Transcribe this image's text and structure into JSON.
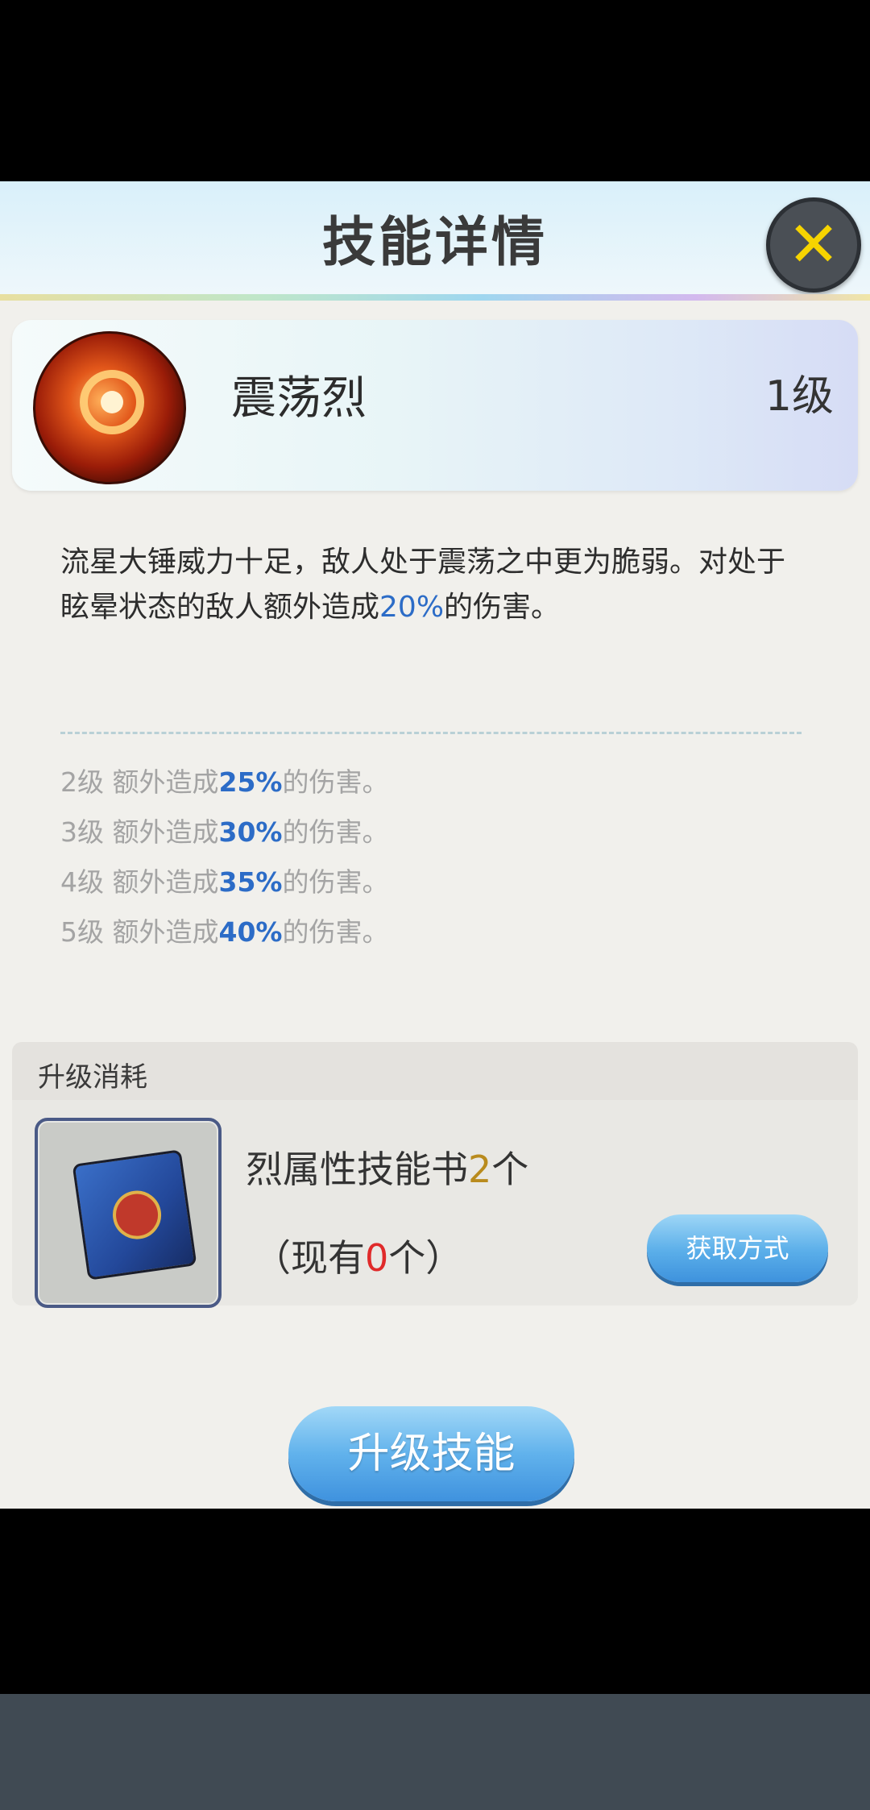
{
  "title": "技能详情",
  "skill": {
    "name": "震荡烈",
    "level": "1级"
  },
  "description": {
    "prefix": "流星大锤威力十足，敌人处于震荡之中更为脆弱。对处于眩晕状态的敌人额外造成",
    "value": "20%",
    "suffix": "的伤害。"
  },
  "levels": [
    {
      "level": "2级",
      "text": " 额外造成",
      "value": "25%",
      "suffix": "的伤害。"
    },
    {
      "level": "3级",
      "text": " 额外造成",
      "value": "30%",
      "suffix": "的伤害。"
    },
    {
      "level": "4级",
      "text": " 额外造成",
      "value": "35%",
      "suffix": "的伤害。"
    },
    {
      "level": "5级",
      "text": " 额外造成",
      "value": "40%",
      "suffix": "的伤害。"
    }
  ],
  "cost": {
    "header": "升级消耗",
    "item_name": "烈属性技能书",
    "item_count": "2",
    "item_unit": "个",
    "owned_prefix": "（现有",
    "owned_count": "0",
    "owned_suffix": "个）",
    "acquire_label": "获取方式"
  },
  "upgrade_label": "升级技能",
  "colors": {
    "highlight": "#2c6cc7",
    "owned_zero": "#e02a2a",
    "count": "#b98b1d",
    "close_x": "#f6d400"
  },
  "icons": [
    "close-icon",
    "skill-icon",
    "skill-book-icon"
  ]
}
